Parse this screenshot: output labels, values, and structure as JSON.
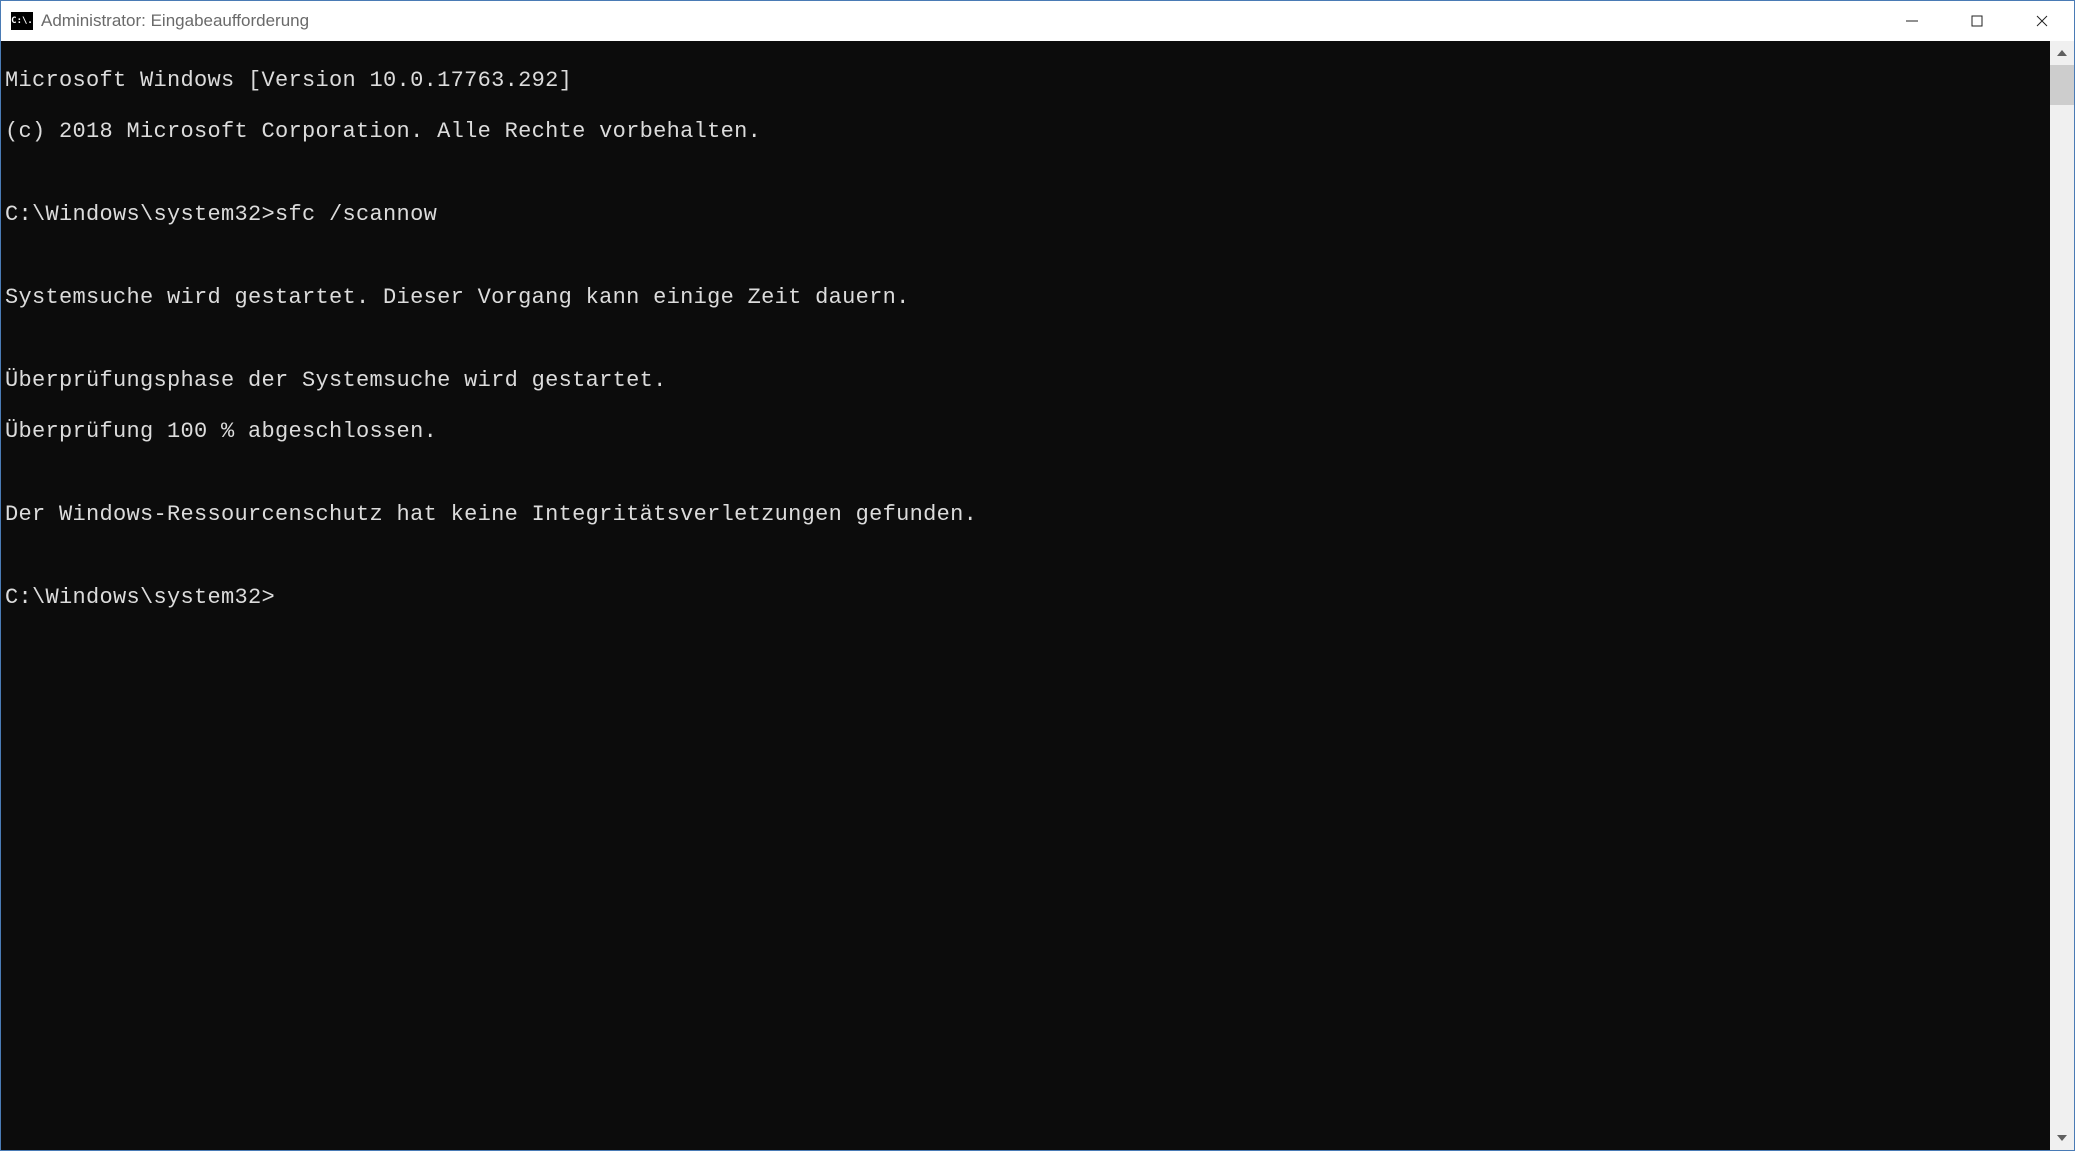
{
  "titlebar": {
    "icon_text": "C:\\.",
    "title": "Administrator: Eingabeaufforderung"
  },
  "terminal": {
    "lines": [
      "Microsoft Windows [Version 10.0.17763.292]",
      "(c) 2018 Microsoft Corporation. Alle Rechte vorbehalten.",
      "",
      "C:\\Windows\\system32>sfc /scannow",
      "",
      "Systemsuche wird gestartet. Dieser Vorgang kann einige Zeit dauern.",
      "",
      "Überprüfungsphase der Systemsuche wird gestartet.",
      "Überprüfung 100 % abgeschlossen.",
      "",
      "Der Windows-Ressourcenschutz hat keine Integritätsverletzungen gefunden.",
      "",
      "C:\\Windows\\system32>"
    ],
    "prompt": "C:\\Windows\\system32>",
    "command": "sfc /scannow",
    "progress_percent": "100"
  }
}
